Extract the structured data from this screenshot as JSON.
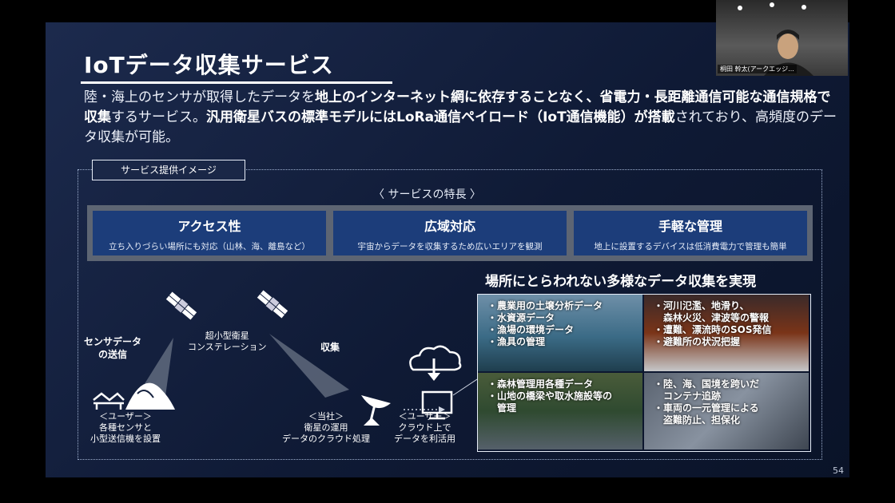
{
  "slide": {
    "title": "IoTデータ収集サービス",
    "lead_parts": [
      {
        "text": "陸・海上のセンサが取得したデータを",
        "bold": false
      },
      {
        "text": "地上のインターネット網に依存することなく、省電力・長距離通信可能な通信規格で収集",
        "bold": true
      },
      {
        "text": "するサービス。",
        "bold": false
      },
      {
        "text": "汎用衛星バスの標準モデルにはLoRa通信ペイロード（IoT通信機能）が搭載",
        "bold": true
      },
      {
        "text": "されており、高頻度のデータ収集が可能。",
        "bold": false
      }
    ],
    "frame_label": "サービス提供イメージ",
    "features_title": "〈 サービスの特長 〉",
    "features": [
      {
        "title": "アクセス性",
        "desc": "立ち入りづらい場所にも対応（山林、海、離島など）"
      },
      {
        "title": "広域対応",
        "desc": "宇宙からデータを収集するため広いエリアを観測"
      },
      {
        "title": "手軽な管理",
        "desc": "地上に設置するデバイスは低消費電力で管理も簡単"
      }
    ],
    "diagram": {
      "sensor_send": "センサデータ\nの送信",
      "constellation": "超小型衛星\nコンステレーション",
      "collect": "収集",
      "user1": "＜ユーザー＞\n各種センサと\n小型送信機を設置",
      "company": "＜当社＞\n衛星の運用\nデータのクラウド処理",
      "user2": "＜ユーザー＞\nクラウド上で\nデータを利活用"
    },
    "headline": "場所にとらわれない多様なデータ収集を実現",
    "photo_panels": [
      {
        "text": "・農業用の土壌分析データ\n・水資源データ\n・漁場の環境データ\n・漁具の管理"
      },
      {
        "text": "・河川氾濫、地滑り、\n　森林火災、津波等の警報\n・遭難、漂流時のSOS発信\n・避難所の状況把握"
      },
      {
        "text": "・森林管理用各種データ\n・山地の橋梁や取水施設等の\n　管理"
      },
      {
        "text": "・陸、海、国境を跨いだ\n　コンテナ追跡\n・車両の一元管理による\n　盗難防止、担保化"
      }
    ],
    "page_number": "54"
  },
  "webcam": {
    "name": "桐田 幹太(アークエッジ..."
  },
  "colors": {
    "slide_bg": "#15213f",
    "feature_box": "#1c3d7a",
    "feature_band": "#5d6573"
  }
}
